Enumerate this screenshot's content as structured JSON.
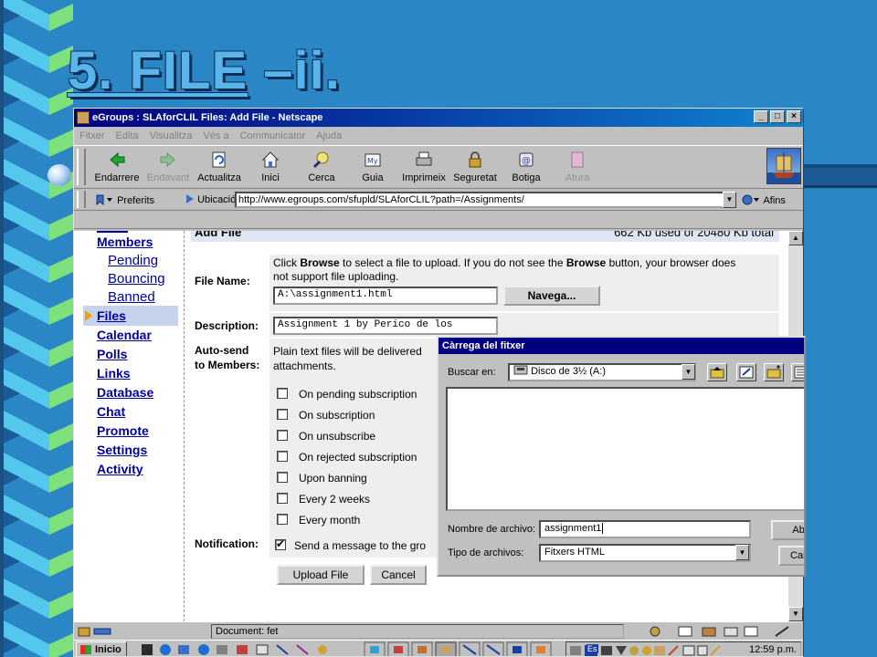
{
  "slide": {
    "title_link": "5. FILE",
    "title_rest": " –ii."
  },
  "window": {
    "title": "eGroups : SLAforCLIL Files: Add File - Netscape",
    "controls": [
      "_",
      "□",
      "×"
    ]
  },
  "menu": [
    "Fitxer",
    "Edita",
    "Visualitza",
    "Vés a",
    "Communicator",
    "Ajuda"
  ],
  "toolbar": [
    {
      "label": "Endarrere",
      "icon": "back-arrow-icon",
      "enabled": true
    },
    {
      "label": "Endavant",
      "icon": "forward-arrow-icon",
      "enabled": false
    },
    {
      "label": "Actualitza",
      "icon": "reload-icon",
      "enabled": true
    },
    {
      "label": "Inici",
      "icon": "home-icon",
      "enabled": true
    },
    {
      "label": "Cerca",
      "icon": "search-icon",
      "enabled": true
    },
    {
      "label": "Guia",
      "icon": "guide-icon",
      "enabled": true
    },
    {
      "label": "Imprimeix",
      "icon": "print-icon",
      "enabled": true
    },
    {
      "label": "Seguretat",
      "icon": "lock-icon",
      "enabled": true
    },
    {
      "label": "Botiga",
      "icon": "shop-icon",
      "enabled": true
    },
    {
      "label": "Atura",
      "icon": "stop-icon",
      "enabled": false
    }
  ],
  "location": {
    "bookmarks_label": "Preferits",
    "location_label": "Ubicació:",
    "url": "http://www.egroups.com/sfupld/SLAforCLIL?path=/Assignments/",
    "related_label": "Afins"
  },
  "page": {
    "header_left": "Add File",
    "header_right": "662 Kb used of 20480 Kb total",
    "nav": [
      {
        "label": "Members",
        "sub": false
      },
      {
        "label": "Pending",
        "sub": true
      },
      {
        "label": "Bouncing",
        "sub": true
      },
      {
        "label": "Banned",
        "sub": true
      },
      {
        "label": "Files",
        "sub": false,
        "selected": true
      },
      {
        "label": "Calendar",
        "sub": false
      },
      {
        "label": "Polls",
        "sub": false
      },
      {
        "label": "Links",
        "sub": false
      },
      {
        "label": "Database",
        "sub": false
      },
      {
        "label": "Chat",
        "sub": false
      },
      {
        "label": "Promote",
        "sub": false
      },
      {
        "label": "Settings",
        "sub": false
      },
      {
        "label": "Activity",
        "sub": false
      }
    ],
    "file_name_label": "File Name:",
    "instructions_1a": "Click ",
    "instructions_1b": "Browse",
    "instructions_1c": " to select a file to upload. If you do not see the ",
    "instructions_1d": "Browse",
    "instructions_1e": " button, your browser does",
    "instructions_2": "not support file uploading.",
    "file_value": "A:\\assignment1.html",
    "browse_button": "Navega...",
    "description_label": "Description:",
    "description_value": "Assignment 1 by Perico de los",
    "autosend_label_1": "Auto-send",
    "autosend_label_2": "to Members:",
    "autosend_text_1": "Plain text files will be delivered",
    "autosend_text_2": "attachments.",
    "checkboxes": [
      {
        "label": "On pending subscription",
        "checked": false
      },
      {
        "label": "On subscription",
        "checked": false
      },
      {
        "label": "On unsubscribe",
        "checked": false
      },
      {
        "label": "On rejected subscription",
        "checked": false
      },
      {
        "label": "Upon banning",
        "checked": false
      },
      {
        "label": "Every 2 weeks",
        "checked": false
      },
      {
        "label": "Every month",
        "checked": false
      }
    ],
    "notification_label": "Notification:",
    "notification_text": "Send a message to the gro",
    "notification_checked": true,
    "upload_button": "Upload File",
    "cancel_button": "Cancel"
  },
  "dialog": {
    "title": "Càrrega del fitxer",
    "look_in_label": "Buscar en:",
    "look_in_value": "Disco de 3½ (A:)",
    "file_name_label": "Nombre de archivo:",
    "file_name_value": "assignment1",
    "file_type_label": "Tipo de archivos:",
    "file_type_value": "Fitxers HTML",
    "open_button": "Abrir",
    "cancel_button": "Cancelar"
  },
  "status": {
    "text": "Document: fet"
  },
  "taskbar": {
    "start_label": "Inicio",
    "clock": "12:59 p.m.",
    "lang": "Es"
  }
}
